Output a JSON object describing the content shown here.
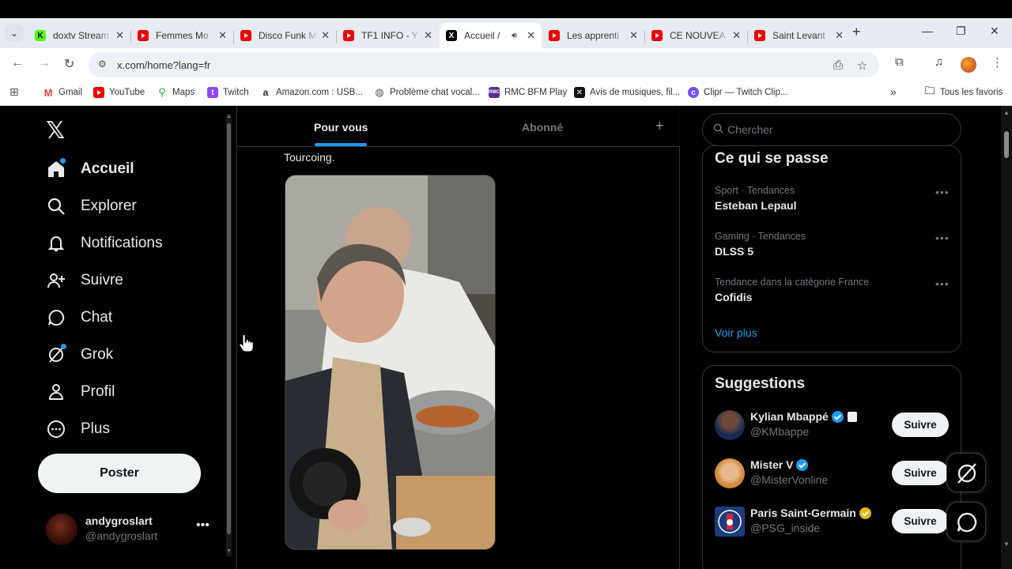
{
  "browser": {
    "tabs": [
      {
        "title": "doxtv Stream",
        "favicon": "kick-icon",
        "color": "#53fc18",
        "active": false
      },
      {
        "title": "Femmes Mo",
        "favicon": "youtube-icon",
        "color": "#ff0000",
        "active": false
      },
      {
        "title": "Disco Funk M",
        "favicon": "youtube-icon",
        "color": "#ff0000",
        "active": false
      },
      {
        "title": "TF1 INFO - Y",
        "favicon": "youtube-icon",
        "color": "#ff0000",
        "active": false
      },
      {
        "title": "Accueil /",
        "favicon": "x-icon",
        "color": "#000000",
        "active": true
      },
      {
        "title": "Les apprenti",
        "favicon": "youtube-icon",
        "color": "#ff0000",
        "active": false
      },
      {
        "title": "CE NOUVEA",
        "favicon": "youtube-icon",
        "color": "#ff0000",
        "active": false
      },
      {
        "title": "Saint Levant",
        "favicon": "youtube-icon",
        "color": "#ff0000",
        "active": false
      }
    ],
    "url": "x.com/home?lang=fr",
    "bookmarks": [
      {
        "label": "Gmail",
        "icon": "gmail-icon",
        "color": "#ea4335"
      },
      {
        "label": "YouTube",
        "icon": "youtube-icon",
        "color": "#ff0000"
      },
      {
        "label": "Maps",
        "icon": "maps-icon",
        "color": "#34a853"
      },
      {
        "label": "Twitch",
        "icon": "twitch-icon",
        "color": "#9146ff"
      },
      {
        "label": "Amazon.com : USB...",
        "icon": "amazon-icon",
        "color": "#222222"
      },
      {
        "label": "Problème chat vocal...",
        "icon": "globe-icon",
        "color": "#555555"
      },
      {
        "label": "RMC BFM Play",
        "icon": "rmc-icon",
        "color": "#5b2d90"
      },
      {
        "label": "Avis de musiques, fil...",
        "icon": "rym-icon",
        "color": "#111111"
      },
      {
        "label": "Clipr — Twitch Clip...",
        "icon": "clipr-icon",
        "color": "#7b4dff"
      }
    ],
    "all_bookmarks": "Tous les favoris"
  },
  "sidebar": {
    "items": [
      {
        "label": "Accueil",
        "icon": "home-icon"
      },
      {
        "label": "Explorer",
        "icon": "search-icon"
      },
      {
        "label": "Notifications",
        "icon": "bell-icon"
      },
      {
        "label": "Suivre",
        "icon": "add-person-icon"
      },
      {
        "label": "Chat",
        "icon": "chat-bubble-icon"
      },
      {
        "label": "Grok",
        "icon": "grok-icon"
      },
      {
        "label": "Profil",
        "icon": "person-icon"
      },
      {
        "label": "Plus",
        "icon": "more-circle-icon"
      }
    ],
    "post_button": "Poster",
    "account": {
      "name": "andygroslart",
      "handle": "@andygroslart"
    }
  },
  "timeline": {
    "tabs": [
      "Pour vous",
      "Abonné"
    ],
    "active_tab": "Pour vous",
    "tweet_text": "Tourcoing."
  },
  "right": {
    "search_placeholder": "Chercher",
    "trends_title": "Ce qui se passe",
    "trends": [
      {
        "meta": "Sport · Tendances",
        "name": "Esteban Lepaul"
      },
      {
        "meta": "Gaming · Tendances",
        "name": "DLSS 5"
      },
      {
        "meta": "Tendance dans la catégorie France",
        "name": "Cofidis"
      }
    ],
    "see_more": "Voir plus",
    "suggestions_title": "Suggestions",
    "suggestions": [
      {
        "name": "Kylian Mbappé",
        "handle": "@KMbappe",
        "badge_color": "#1d9bf0",
        "follow": "Suivre"
      },
      {
        "name": "Mister V",
        "handle": "@MisterVonline",
        "badge_color": "#1d9bf0",
        "follow": "Suivre"
      },
      {
        "name": "Paris Saint-Germain",
        "handle": "@PSG_inside",
        "badge_color": "#e2b719",
        "follow": "Suivre"
      }
    ]
  },
  "colors": {
    "accent": "#1d9bf0",
    "text": "#e7e9ea",
    "muted": "#71767b"
  }
}
